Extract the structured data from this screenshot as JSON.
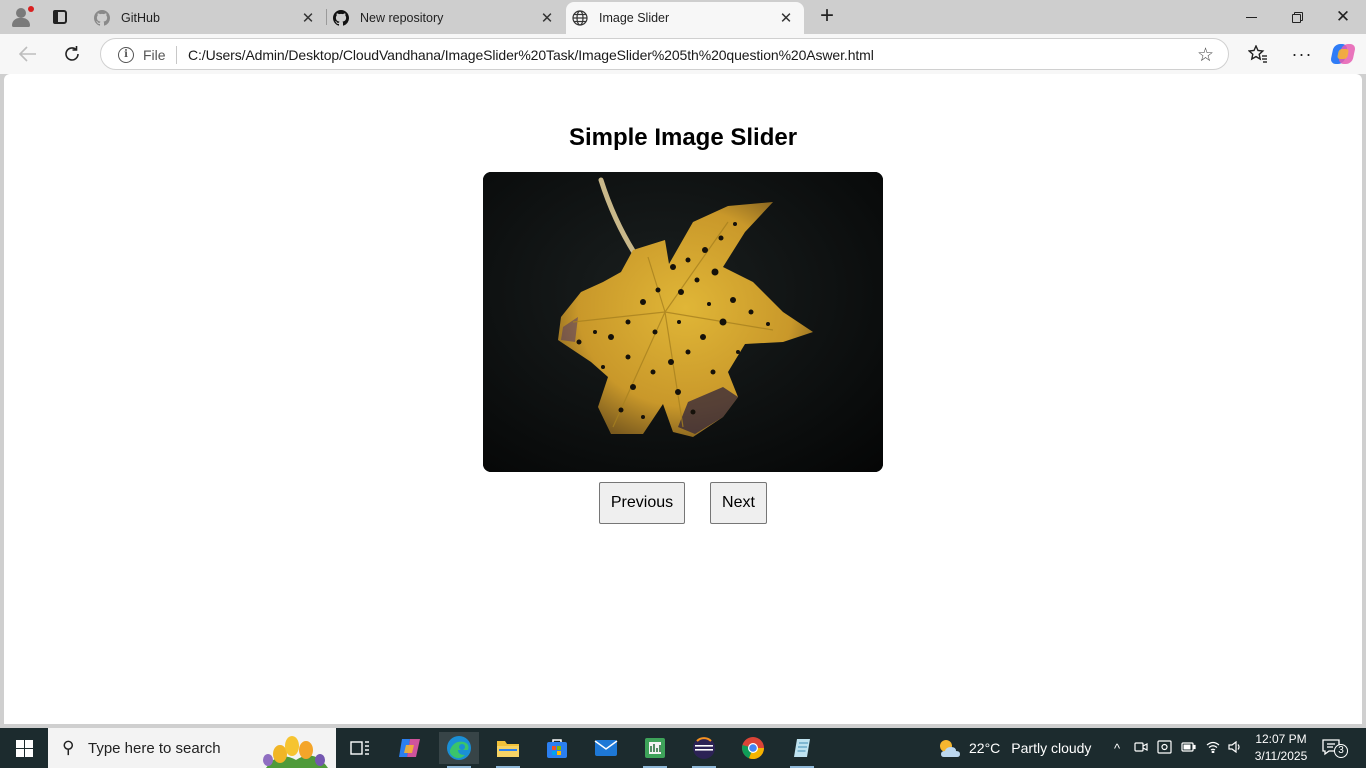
{
  "browser": {
    "tabs": [
      {
        "title": "GitHub",
        "icon": "github-icon",
        "active": false
      },
      {
        "title": "New repository",
        "icon": "github-icon",
        "active": false
      },
      {
        "title": "Image Slider",
        "icon": "globe-icon",
        "active": true
      }
    ],
    "address": {
      "scheme_label": "File",
      "url": "C:/Users/Admin/Desktop/CloudVandhana/ImageSlider%20Task/ImageSlider%205th%20question%20Aswer.html"
    }
  },
  "page": {
    "title": "Simple Image Slider",
    "image_alt": "yellow-leaf-photo",
    "buttons": {
      "previous": "Previous",
      "next": "Next"
    }
  },
  "taskbar": {
    "search_placeholder": "Type here to search",
    "pinned": [
      "task-view-icon",
      "copilot-icon",
      "edge-icon",
      "file-explorer-icon",
      "microsoft-store-icon",
      "mail-icon",
      "spreadsheet-app-icon",
      "eclipse-icon",
      "chrome-icon",
      "notepad-icon"
    ],
    "weather": {
      "temp": "22°C",
      "condition": "Partly cloudy"
    },
    "time": "12:07 PM",
    "date": "3/11/2025",
    "notifications": "3"
  },
  "colors": {
    "tabstrip": "#cecece",
    "toolbar": "#f7f7f7",
    "taskbar": "#1c2b2e",
    "button_bg": "#efefef",
    "leaf_yellow": "#d4a82a"
  }
}
